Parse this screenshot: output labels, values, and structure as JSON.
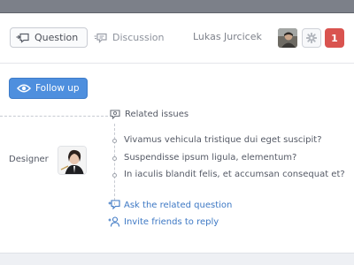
{
  "header": {
    "tabs": [
      {
        "label": "Question",
        "icon": "question-icon",
        "active": true
      },
      {
        "label": "Discussion",
        "icon": "discussion-icon",
        "active": false
      }
    ],
    "user": {
      "name": "Lukas Jurcicek",
      "avatar": "user-avatar"
    },
    "settings_icon": "gear-icon",
    "notifications": {
      "count": "1",
      "color": "#d9534f"
    }
  },
  "follow_button": {
    "label": "Follow up",
    "icon": "eye-icon",
    "color": "#4e8fde"
  },
  "related": {
    "label": "Related issues",
    "role": "Designer",
    "issues": [
      "Vivamus vehicula tristique dui eget suscipit?",
      "Suspendisse ipsum ligula, elementum?",
      "In iaculis blandit felis, et accumsan consequat et?"
    ],
    "ask_link": "Ask the related question",
    "invite_link": "Invite friends to reply",
    "link_color": "#3d78c4"
  }
}
